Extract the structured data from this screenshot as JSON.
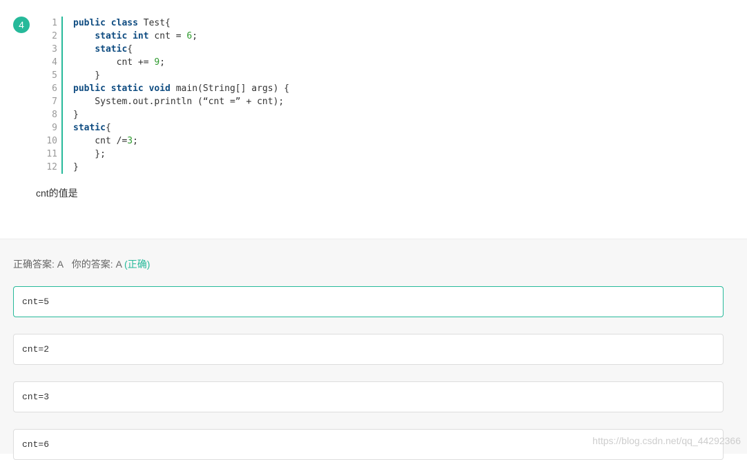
{
  "question": {
    "number": "4",
    "code_lines": [
      {
        "n": "1",
        "tokens": [
          {
            "t": "public class",
            "c": "kw"
          },
          {
            "t": " Test{",
            "c": ""
          }
        ]
      },
      {
        "n": "2",
        "tokens": [
          {
            "t": "    ",
            "c": ""
          },
          {
            "t": "static int",
            "c": "kw"
          },
          {
            "t": " cnt = ",
            "c": ""
          },
          {
            "t": "6",
            "c": "num"
          },
          {
            "t": ";",
            "c": ""
          }
        ]
      },
      {
        "n": "3",
        "tokens": [
          {
            "t": "    ",
            "c": ""
          },
          {
            "t": "static",
            "c": "kw"
          },
          {
            "t": "{",
            "c": ""
          }
        ]
      },
      {
        "n": "4",
        "tokens": [
          {
            "t": "        cnt += ",
            "c": ""
          },
          {
            "t": "9",
            "c": "num"
          },
          {
            "t": ";",
            "c": ""
          }
        ]
      },
      {
        "n": "5",
        "tokens": [
          {
            "t": "    }",
            "c": ""
          }
        ]
      },
      {
        "n": "6",
        "tokens": [
          {
            "t": "public static void",
            "c": "kw"
          },
          {
            "t": " main(String[] args) {",
            "c": ""
          }
        ]
      },
      {
        "n": "7",
        "tokens": [
          {
            "t": "    System.out.println (“cnt =” + cnt);",
            "c": ""
          }
        ]
      },
      {
        "n": "8",
        "tokens": [
          {
            "t": "}",
            "c": ""
          }
        ]
      },
      {
        "n": "9",
        "tokens": [
          {
            "t": "static",
            "c": "kw"
          },
          {
            "t": "{",
            "c": ""
          }
        ]
      },
      {
        "n": "10",
        "tokens": [
          {
            "t": "    cnt /=",
            "c": ""
          },
          {
            "t": "3",
            "c": "num"
          },
          {
            "t": ";",
            "c": ""
          }
        ]
      },
      {
        "n": "11",
        "tokens": [
          {
            "t": "    };",
            "c": ""
          }
        ]
      },
      {
        "n": "12",
        "tokens": [
          {
            "t": "}",
            "c": ""
          }
        ]
      }
    ],
    "prompt": "cnt的值是"
  },
  "result": {
    "correct_label": "正确答案: A",
    "your_label": "你的答案: A",
    "status": "(正确)"
  },
  "options": [
    {
      "text": "cnt=5",
      "selected": true
    },
    {
      "text": "cnt=2",
      "selected": false
    },
    {
      "text": "cnt=3",
      "selected": false
    },
    {
      "text": "cnt=6",
      "selected": false
    }
  ],
  "watermark": "https://blog.csdn.net/qq_44292366",
  "colors": {
    "accent": "#26b99a",
    "keyword": "#0f4c81",
    "number": "#2e9a2e"
  }
}
